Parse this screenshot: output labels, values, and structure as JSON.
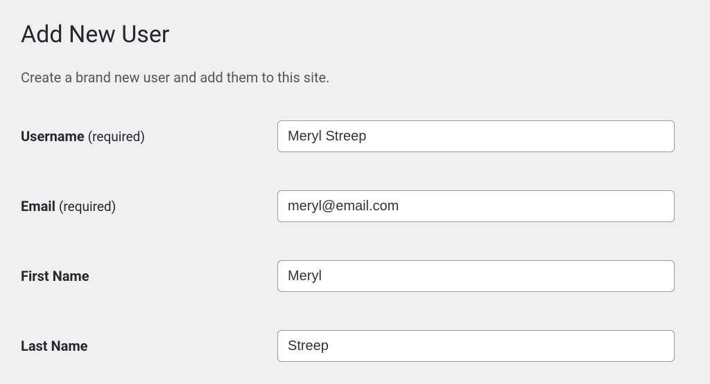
{
  "header": {
    "title": "Add New User",
    "description": "Create a brand new user and add them to this site."
  },
  "form": {
    "username": {
      "label": "Username",
      "hint": "(required)",
      "value": "Meryl Streep"
    },
    "email": {
      "label": "Email",
      "hint": "(required)",
      "value": "meryl@email.com"
    },
    "first_name": {
      "label": "First Name",
      "value": "Meryl"
    },
    "last_name": {
      "label": "Last Name",
      "value": "Streep"
    }
  }
}
